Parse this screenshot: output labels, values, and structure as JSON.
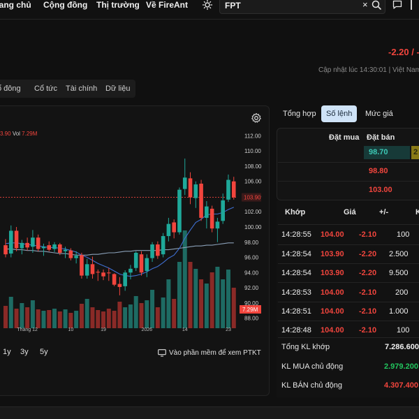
{
  "nav": {
    "items": [
      "rang chủ",
      "Cộng đồng",
      "Thị trường",
      "Về FireAnt"
    ],
    "search_value": "FPT",
    "clear_glyph": "×"
  },
  "header": {
    "price_change": "-2.20 / -",
    "update_time": "Cập nhật lúc 14:30:01 | Việt Nam"
  },
  "tabs": [
    "ổ đông",
    "Cổ tức",
    "Tài chính",
    "Dữ liệu"
  ],
  "chart_header": {
    "ohlc_partial": "3.90",
    "vol_label": "Vol",
    "vol_value": "7.29M"
  },
  "range_buttons": [
    "1y",
    "3y",
    "5y"
  ],
  "ptkt_label": "Vào phần mềm để xem PTKT",
  "chart_data": {
    "type": "candlestick",
    "price_ticks": [
      "112.00",
      "110.00",
      "108.00",
      "106.00",
      "104.00",
      "102.00",
      "100.00",
      "98.00",
      "96.00",
      "94.00",
      "92.00",
      "90.00",
      "88.00"
    ],
    "x_ticks": [
      "Tháng 12",
      "10",
      "19",
      "2026",
      "14",
      "23"
    ],
    "last_price_tag": "103.90",
    "volume_tag": "7.29M",
    "ylim": [
      87.5,
      112.5
    ],
    "candles": [
      {
        "o": 97.6,
        "h": 98.4,
        "l": 96.0,
        "c": 96.4
      },
      {
        "o": 96.5,
        "h": 100.2,
        "l": 96.0,
        "c": 99.5
      },
      {
        "o": 99.5,
        "h": 100.0,
        "l": 96.8,
        "c": 97.2
      },
      {
        "o": 97.2,
        "h": 98.3,
        "l": 96.4,
        "c": 97.9
      },
      {
        "o": 97.9,
        "h": 98.6,
        "l": 96.9,
        "c": 97.3
      },
      {
        "o": 97.4,
        "h": 99.6,
        "l": 96.6,
        "c": 98.6
      },
      {
        "o": 98.6,
        "h": 99.0,
        "l": 96.8,
        "c": 97.1
      },
      {
        "o": 97.2,
        "h": 97.8,
        "l": 96.2,
        "c": 97.4
      },
      {
        "o": 97.6,
        "h": 98.1,
        "l": 96.8,
        "c": 97.0
      },
      {
        "o": 97.1,
        "h": 98.0,
        "l": 96.7,
        "c": 97.7
      },
      {
        "o": 97.7,
        "h": 97.9,
        "l": 96.3,
        "c": 96.6
      },
      {
        "o": 96.8,
        "h": 97.4,
        "l": 95.9,
        "c": 97.0
      },
      {
        "o": 96.9,
        "h": 97.2,
        "l": 95.6,
        "c": 95.9
      },
      {
        "o": 95.9,
        "h": 96.8,
        "l": 95.2,
        "c": 96.2
      },
      {
        "o": 96.3,
        "h": 96.6,
        "l": 93.2,
        "c": 93.6
      },
      {
        "o": 93.6,
        "h": 95.8,
        "l": 93.2,
        "c": 95.1
      },
      {
        "o": 95.1,
        "h": 96.1,
        "l": 93.2,
        "c": 93.8
      },
      {
        "o": 94.1,
        "h": 94.4,
        "l": 92.9,
        "c": 94.0
      },
      {
        "o": 94.0,
        "h": 94.4,
        "l": 93.0,
        "c": 93.5
      },
      {
        "o": 94.0,
        "h": 94.6,
        "l": 92.9,
        "c": 93.9
      },
      {
        "o": 93.8,
        "h": 93.9,
        "l": 92.2,
        "c": 92.4
      },
      {
        "o": 92.5,
        "h": 93.4,
        "l": 91.0,
        "c": 92.1
      },
      {
        "o": 92.2,
        "h": 94.3,
        "l": 91.6,
        "c": 94.0
      },
      {
        "o": 94.0,
        "h": 95.0,
        "l": 93.1,
        "c": 94.5
      },
      {
        "o": 94.6,
        "h": 96.8,
        "l": 94.2,
        "c": 96.6
      },
      {
        "o": 96.4,
        "h": 96.8,
        "l": 93.6,
        "c": 94.0
      },
      {
        "o": 94.2,
        "h": 96.4,
        "l": 93.4,
        "c": 95.9
      },
      {
        "o": 95.9,
        "h": 98.0,
        "l": 95.4,
        "c": 97.7
      },
      {
        "o": 97.7,
        "h": 98.1,
        "l": 95.8,
        "c": 96.2
      },
      {
        "o": 96.4,
        "h": 99.2,
        "l": 96.0,
        "c": 98.8
      },
      {
        "o": 98.8,
        "h": 101.2,
        "l": 98.1,
        "c": 100.4
      },
      {
        "o": 100.6,
        "h": 101.0,
        "l": 98.5,
        "c": 99.3
      },
      {
        "o": 99.3,
        "h": 105.2,
        "l": 99.0,
        "c": 104.9
      },
      {
        "o": 105.0,
        "h": 109.0,
        "l": 104.2,
        "c": 106.5
      },
      {
        "o": 106.4,
        "h": 107.2,
        "l": 103.0,
        "c": 103.9
      },
      {
        "o": 103.8,
        "h": 106.0,
        "l": 102.5,
        "c": 105.6
      },
      {
        "o": 105.7,
        "h": 106.2,
        "l": 100.8,
        "c": 101.2
      },
      {
        "o": 101.2,
        "h": 103.4,
        "l": 99.8,
        "c": 102.7
      },
      {
        "o": 102.4,
        "h": 102.8,
        "l": 99.3,
        "c": 99.8
      },
      {
        "o": 99.8,
        "h": 101.2,
        "l": 98.0,
        "c": 100.7
      },
      {
        "o": 100.8,
        "h": 104.4,
        "l": 100.4,
        "c": 103.5
      },
      {
        "o": 103.6,
        "h": 106.9,
        "l": 103.3,
        "c": 106.2
      },
      {
        "o": 106.0,
        "h": 106.6,
        "l": 103.6,
        "c": 103.9
      }
    ],
    "volume": [
      32,
      45,
      28,
      36,
      30,
      40,
      27,
      25,
      26,
      28,
      24,
      27,
      22,
      25,
      35,
      42,
      30,
      26,
      24,
      28,
      25,
      38,
      30,
      34,
      46,
      36,
      40,
      55,
      30,
      44,
      70,
      42,
      95,
      140,
      95,
      85,
      70,
      64,
      80,
      88,
      70,
      84,
      58
    ],
    "ma_short": [
      97.8,
      97.9,
      97.9,
      97.8,
      97.7,
      97.6,
      97.5,
      97.4,
      97.3,
      97.3,
      97.2,
      97.1,
      96.9,
      96.7,
      96.3,
      96.0,
      95.6,
      95.2,
      94.9,
      94.6,
      94.2,
      93.8,
      93.6,
      93.5,
      93.6,
      93.8,
      94.1,
      94.5,
      94.8,
      95.3,
      95.9,
      96.3,
      97.2,
      98.5,
      99.6,
      100.6,
      101.0,
      101.6,
      101.7,
      101.7,
      101.9,
      102.3,
      102.6
    ],
    "ma_long": [
      97.1,
      97.1,
      97.0,
      97.0,
      96.9,
      96.9,
      96.8,
      96.8,
      96.7,
      96.6,
      96.5,
      96.5,
      96.4,
      96.3,
      96.3,
      96.3,
      96.4,
      96.4,
      96.5,
      96.6,
      96.6,
      96.7,
      96.8,
      96.8,
      96.9,
      96.9,
      96.9,
      96.9,
      96.9,
      97.0,
      97.0,
      97.1,
      97.2,
      97.3,
      97.4,
      97.5,
      97.5,
      97.6,
      97.6,
      97.7,
      97.8,
      97.9,
      97.9
    ]
  },
  "right_tabs": [
    "Tổng hợp",
    "Số lệnh",
    "Mức giá"
  ],
  "order_book": {
    "header_buy": "Đặt mua",
    "header_sell": "Đặt bán",
    "buy_price": "98.70",
    "sell_partial": "2",
    "asks": [
      "98.80",
      "103.00"
    ]
  },
  "trades": {
    "headers": [
      "Khớp",
      "Giá",
      "+/-",
      "K"
    ],
    "rows": [
      {
        "time": "14:28:55",
        "price": "104.00",
        "change": "-2.10",
        "vol": "100"
      },
      {
        "time": "14:28:54",
        "price": "103.90",
        "change": "-2.20",
        "vol": "2.500"
      },
      {
        "time": "14:28:54",
        "price": "103.90",
        "change": "-2.20",
        "vol": "9.500"
      },
      {
        "time": "14:28:53",
        "price": "104.00",
        "change": "-2.10",
        "vol": "200"
      },
      {
        "time": "14:28:51",
        "price": "104.00",
        "change": "-2.10",
        "vol": "1.000"
      },
      {
        "time": "14:28:48",
        "price": "104.00",
        "change": "-2.10",
        "vol": "100"
      }
    ]
  },
  "summary": [
    {
      "label": "Tổng KL khớp",
      "value": "7.286.600",
      "color": "#f0f0f0"
    },
    {
      "label": "KL MUA chủ động",
      "value": "2.979.200",
      "color": "#22c55e"
    },
    {
      "label": "KL BÁN chủ động",
      "value": "4.307.400",
      "color": "#f2453d"
    }
  ],
  "colors": {
    "up": "#1fa99a",
    "down": "#f2453d",
    "ma_short": "#3f6fd1",
    "ma_long": "#8aa0b8",
    "accent": "#cfe3f7"
  }
}
